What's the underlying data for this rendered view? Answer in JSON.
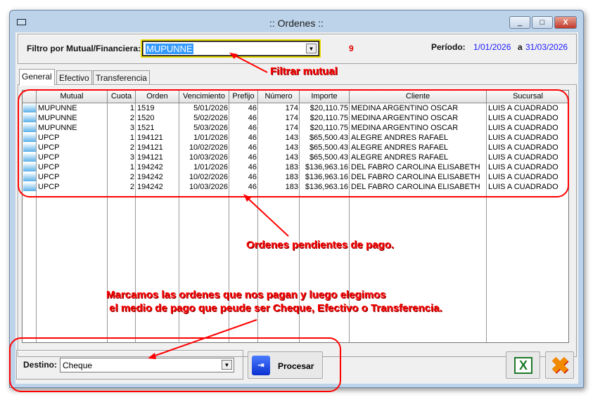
{
  "window": {
    "title": ":: Ordenes ::",
    "minimize": "_",
    "maximize": "□",
    "close": "X"
  },
  "filter": {
    "label": "Filtro por Mutual/Financiera:",
    "value": "MUPUNNE",
    "count": "9",
    "period_label": "Período:",
    "period_from": "1/01/2026",
    "period_sep": "a",
    "period_to": "31/03/2026"
  },
  "tabs": [
    {
      "label": "General",
      "active": true
    },
    {
      "label": "Efectivo"
    },
    {
      "label": "Transferencia"
    }
  ],
  "grid": {
    "columns": [
      "Mutual",
      "Cuota",
      "Orden",
      "Vencimiento",
      "Prefijo",
      "Número",
      "Importe",
      "Cliente",
      "Sucursal"
    ],
    "rows": [
      [
        "MUPUNNE",
        "1",
        "1519",
        "5/01/2026",
        "46",
        "174",
        "$20,110.75",
        "MEDINA ARGENTINO OSCAR",
        "LUIS A CUADRADO"
      ],
      [
        "MUPUNNE",
        "2",
        "1520",
        "5/02/2026",
        "46",
        "174",
        "$20,110.75",
        "MEDINA ARGENTINO OSCAR",
        "LUIS A CUADRADO"
      ],
      [
        "MUPUNNE",
        "3",
        "1521",
        "5/03/2026",
        "46",
        "174",
        "$20,110.75",
        "MEDINA ARGENTINO OSCAR",
        "LUIS A CUADRADO"
      ],
      [
        "UPCP",
        "1",
        "194121",
        "1/01/2026",
        "46",
        "143",
        "$65,500.43",
        "ALEGRE ANDRES RAFAEL",
        "LUIS A CUADRADO"
      ],
      [
        "UPCP",
        "2",
        "194121",
        "10/02/2026",
        "46",
        "143",
        "$65,500.43",
        "ALEGRE ANDRES RAFAEL",
        "LUIS A CUADRADO"
      ],
      [
        "UPCP",
        "3",
        "194121",
        "10/03/2026",
        "46",
        "143",
        "$65,500.43",
        "ALEGRE ANDRES RAFAEL",
        "LUIS A CUADRADO"
      ],
      [
        "UPCP",
        "1",
        "194242",
        "1/01/2026",
        "46",
        "183",
        "$136,963.16",
        "DEL FABRO CAROLINA ELISABETH",
        "LUIS A CUADRADO"
      ],
      [
        "UPCP",
        "2",
        "194242",
        "10/02/2026",
        "46",
        "183",
        "$136,963.16",
        "DEL FABRO CAROLINA ELISABETH",
        "LUIS A CUADRADO"
      ],
      [
        "UPCP",
        "2",
        "194242",
        "10/03/2026",
        "46",
        "183",
        "$136,963.16",
        "DEL FABRO CAROLINA ELISABETH",
        "LUIS A CUADRADO"
      ]
    ]
  },
  "bottom": {
    "destino_label": "Destino:",
    "destino_value": "Cheque",
    "procesar_label": "Procesar"
  },
  "annotations": {
    "filtrar": "Filtrar mutual",
    "pendientes": "Ordenes pendientes de pago.",
    "line1": "Marcamos las ordenes que nos pagan y luego elegimos",
    "line2": " el medio de pago que peude ser Cheque, Efectivo o Transferencia.",
    "color": "#ff0000"
  },
  "colors": {
    "period": "#1a1aff",
    "count": "#e00000",
    "selection": "#3399ff"
  }
}
